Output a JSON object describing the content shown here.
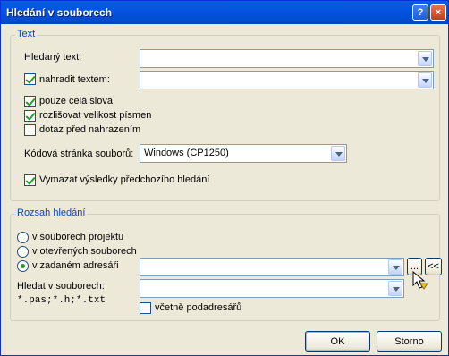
{
  "window": {
    "title": "Hledání v souborech",
    "help_label": "?",
    "close_label": "×"
  },
  "text_group": {
    "legend": "Text",
    "search_label": "Hledaný text:",
    "search_value": "",
    "replace_label": "nahradit textem:",
    "replace_checked": true,
    "replace_value": "",
    "whole_words_label": "pouze celá slova",
    "whole_words_checked": true,
    "case_label": "rozlišovat velikost písmen",
    "case_checked": true,
    "prompt_label": "dotaz před nahrazením",
    "prompt_checked": false,
    "codepage_label": "Kódová stránka souborů:",
    "codepage_value": "Windows (CP1250)",
    "clear_label": "Vymazat výsledky předchozího hledání",
    "clear_checked": true
  },
  "scope_group": {
    "legend": "Rozsah hledání",
    "project_label": "v souborech projektu",
    "open_label": "v otevřených souborech",
    "dir_label": "v zadaném adresáři",
    "selected": "dir",
    "dir_value": "",
    "browse_label": "...",
    "collapse_label": "<<",
    "files_label": "Hledat v souborech:",
    "files_value": "",
    "mask_hint": "*.pas;*.h;*.txt",
    "subdirs_label": "včetně podadresářů",
    "subdirs_checked": false
  },
  "buttons": {
    "ok": "OK",
    "cancel": "Storno"
  },
  "icons": {
    "cursor": "mouse-pointer-icon"
  }
}
